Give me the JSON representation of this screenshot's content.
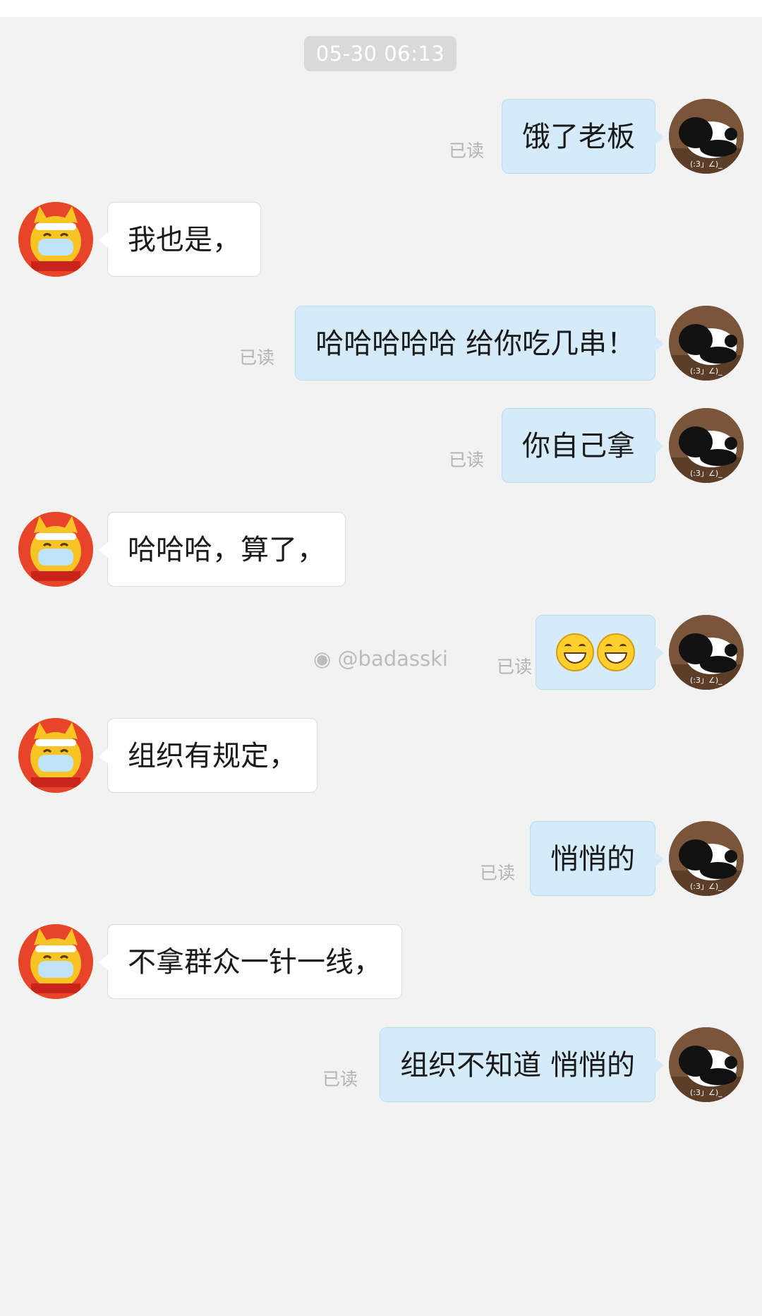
{
  "timestamp": "05-30 06:13",
  "read_label": "已读",
  "watermark": "@badasski",
  "messages": [
    {
      "side": "me",
      "text": "饿了老板",
      "read": true
    },
    {
      "side": "other",
      "text": "我也是，"
    },
    {
      "side": "me",
      "text": "哈哈哈哈哈 给你吃几串！",
      "read": true
    },
    {
      "side": "me",
      "text": "你自己拿",
      "read": true
    },
    {
      "side": "other",
      "text": "哈哈哈，算了，"
    },
    {
      "side": "me",
      "text": "",
      "emoji": [
        "grin-emoji",
        "grin-emoji"
      ],
      "read": true
    },
    {
      "side": "other",
      "text": "组织有规定，"
    },
    {
      "side": "me",
      "text": "悄悄的",
      "read": true
    },
    {
      "side": "other",
      "text": "不拿群众一针一线，"
    },
    {
      "side": "me",
      "text": "组织不知道 悄悄的",
      "read": true
    }
  ],
  "colors": {
    "me_bubble": "#d5ebfa",
    "other_bubble": "#ffffff",
    "background": "#f2f2f2"
  }
}
